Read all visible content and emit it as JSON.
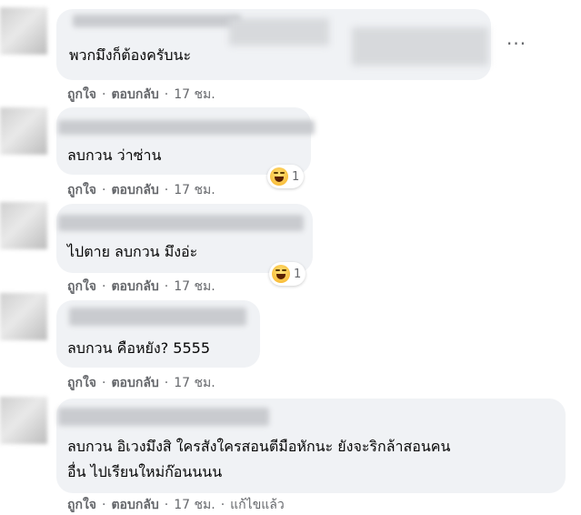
{
  "comments": [
    {
      "text": "พวกมึงก็ต้องครับนะ",
      "actions": {
        "like": "ถูกใจ",
        "reply": "ตอบกลับ",
        "time": "17 ชม.",
        "edited": ""
      },
      "reaction": null
    },
    {
      "text": "ลบกวน ว่าซ่าน",
      "actions": {
        "like": "ถูกใจ",
        "reply": "ตอบกลับ",
        "time": "17 ชม.",
        "edited": ""
      },
      "reaction": {
        "icon": "haha-icon",
        "count": "1"
      }
    },
    {
      "text": "ไปตาย ลบกวน มึงอ่ะ",
      "actions": {
        "like": "ถูกใจ",
        "reply": "ตอบกลับ",
        "time": "17 ชม.",
        "edited": ""
      },
      "reaction": {
        "icon": "haha-icon",
        "count": "1"
      }
    },
    {
      "text": "ลบกวน คือหยัง? 5555",
      "actions": {
        "like": "ถูกใจ",
        "reply": "ตอบกลับ",
        "time": "17 ชม.",
        "edited": ""
      },
      "reaction": null
    },
    {
      "text_line1": "ลบกวน อิเวงมึงสิ ใครสังใครสอนตีมือหักนะ ยังจะริกล้าสอนคน",
      "text_line2": "อื่น ไปเรียนใหม่ก๊อนนนน",
      "actions": {
        "like": "ถูกใจ",
        "reply": "ตอบกลับ",
        "time": "17 ชม.",
        "edited": "แก้ไขแล้ว"
      },
      "reaction": null
    }
  ],
  "more_icon": "more-options-icon",
  "separator": "·"
}
